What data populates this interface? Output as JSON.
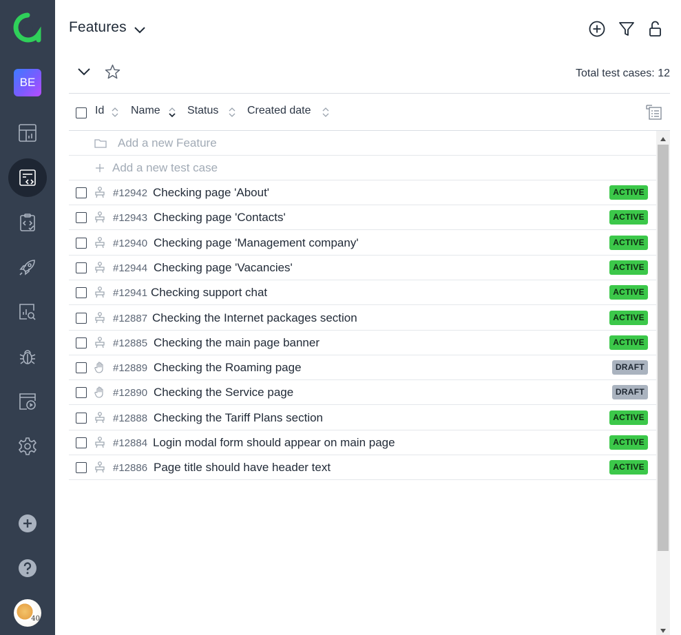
{
  "app": {
    "logo": "a-logo",
    "project_badge": "BE"
  },
  "sidebar": {
    "items": [
      {
        "name": "dashboards-icon"
      },
      {
        "name": "test-cases-icon",
        "active": true
      },
      {
        "name": "test-plans-icon"
      },
      {
        "name": "launches-icon"
      },
      {
        "name": "analytics-icon"
      },
      {
        "name": "defects-icon"
      },
      {
        "name": "jobs-icon"
      },
      {
        "name": "settings-icon"
      }
    ],
    "bottom": [
      {
        "name": "add-icon"
      },
      {
        "name": "help-icon"
      }
    ],
    "avatar_text": "40"
  },
  "header": {
    "title": "Features",
    "actions": [
      "add-icon",
      "filter-icon",
      "unlock-icon"
    ]
  },
  "toolbar": {
    "total": "Total test cases: 12"
  },
  "columns": [
    {
      "label": "Id"
    },
    {
      "label": "Name"
    },
    {
      "label": "Status"
    },
    {
      "label": "Created date"
    }
  ],
  "add_feature": "Add a new Feature",
  "add_test_case": "Add a new test case",
  "rows": [
    {
      "id": "#12942",
      "name": "Checking page 'About'",
      "status": "ACTIVE",
      "type": "automated"
    },
    {
      "id": "#12943",
      "name": "Checking page 'Contacts'",
      "status": "ACTIVE",
      "type": "automated"
    },
    {
      "id": "#12940",
      "name": "Checking page 'Management company'",
      "status": "ACTIVE",
      "type": "automated"
    },
    {
      "id": "#12944",
      "name": "Checking page 'Vacancies'",
      "status": "ACTIVE",
      "type": "automated"
    },
    {
      "id": "#12941",
      "name": "Checking support chat",
      "status": "ACTIVE",
      "type": "automated"
    },
    {
      "id": "#12887",
      "name": "Checking the Internet packages section",
      "status": "ACTIVE",
      "type": "automated"
    },
    {
      "id": "#12885",
      "name": "Checking the main page banner",
      "status": "ACTIVE",
      "type": "automated"
    },
    {
      "id": "#12889",
      "name": "Checking the Roaming page",
      "status": "DRAFT",
      "type": "manual"
    },
    {
      "id": "#12890",
      "name": "Checking the Service page",
      "status": "DRAFT",
      "type": "manual"
    },
    {
      "id": "#12888",
      "name": "Checking the Tariff Plans section",
      "status": "ACTIVE",
      "type": "automated"
    },
    {
      "id": "#12884",
      "name": "Login modal form should appear on main page",
      "status": "ACTIVE",
      "type": "automated"
    },
    {
      "id": "#12886",
      "name": "Page title should have header text",
      "status": "ACTIVE",
      "type": "automated"
    }
  ],
  "colors": {
    "sidebar": "#343f4f",
    "active_nav": "#1e2633",
    "active_badge": "#3cc84a",
    "draft_badge": "#aab3bf",
    "accent": "#2fd05a"
  }
}
